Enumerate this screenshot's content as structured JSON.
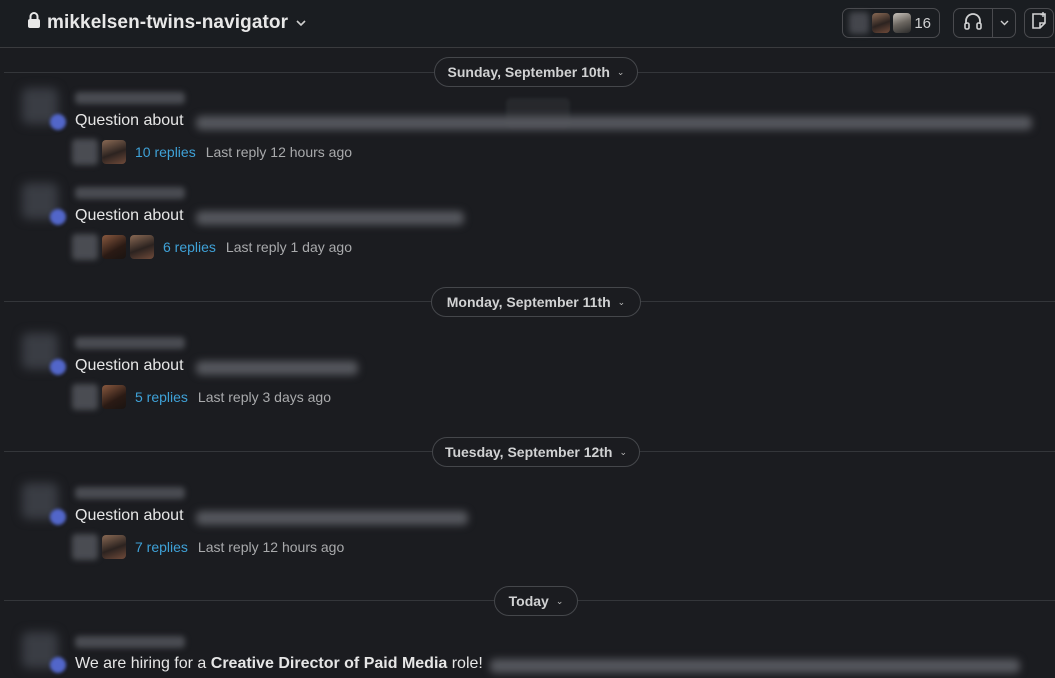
{
  "header": {
    "channel_name": "mikkelsen-twins-navigator",
    "member_count": "16"
  },
  "dates": [
    {
      "label": "Sunday, September 10th"
    },
    {
      "label": "Monday, September 11th"
    },
    {
      "label": "Tuesday, September 12th"
    },
    {
      "label": "Today"
    }
  ],
  "messages": [
    {
      "text": "Question about ",
      "replies": "10 replies",
      "last_reply": "Last reply 12 hours ago"
    },
    {
      "text": "Question about ",
      "replies": "6 replies",
      "last_reply": "Last reply 1 day ago"
    },
    {
      "text": "Question about ",
      "replies": "5 replies",
      "last_reply": "Last reply 3 days ago"
    },
    {
      "text": "Question about ",
      "replies": "7 replies",
      "last_reply": "Last reply 12 hours ago"
    },
    {
      "text_before": "We are hiring for a ",
      "text_bold": "Creative Director of Paid Media",
      "text_after": " role!"
    }
  ],
  "colors": {
    "background": "#1b1c20",
    "link": "#3fa2d8",
    "accent_dot": "#5266c9"
  },
  "icons": [
    "lock-icon",
    "chevron-down-icon",
    "headphones-icon",
    "canvas-icon"
  ]
}
